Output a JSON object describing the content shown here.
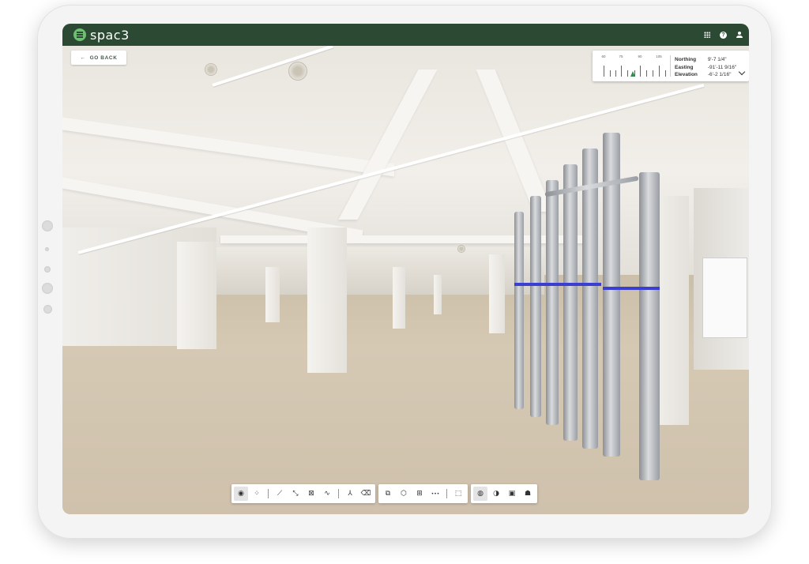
{
  "app": {
    "brand": "spac3"
  },
  "header": {
    "icons": [
      "grid-icon",
      "help-icon",
      "user-icon"
    ]
  },
  "navigation": {
    "go_back_label": "GO BACK",
    "go_back_arrow": "←"
  },
  "compass": {
    "tick_labels": [
      "60",
      "75",
      "90",
      "105"
    ],
    "needle_color": "#2f8f4a",
    "coordinates": [
      {
        "label": "Northing",
        "value": "9'-7 1/4\""
      },
      {
        "label": "Easting",
        "value": "-91'-11 9/16\""
      },
      {
        "label": "Elevation",
        "value": "-6'-2 1/16\""
      }
    ]
  },
  "toolbar": {
    "groups": [
      {
        "name": "view-tools",
        "items": [
          {
            "name": "pano-view-icon",
            "glyph": "◉",
            "active": true
          },
          {
            "name": "scan-points-icon",
            "glyph": "⁘",
            "active": false
          },
          {
            "sep": true
          },
          {
            "name": "measure-icon",
            "glyph": "⟋",
            "active": false
          },
          {
            "name": "measure-segments-icon",
            "glyph": "⤡",
            "active": false
          },
          {
            "name": "area-icon",
            "glyph": "⊠",
            "active": false
          },
          {
            "name": "polyline-icon",
            "glyph": "∿",
            "active": false
          },
          {
            "sep": true
          },
          {
            "name": "axis-icon",
            "glyph": "⅄",
            "active": false
          },
          {
            "name": "eraser-icon",
            "glyph": "⌫",
            "active": false
          }
        ]
      },
      {
        "name": "model-tools",
        "items": [
          {
            "name": "model-overlay-icon",
            "glyph": "⧉",
            "active": false
          },
          {
            "name": "cube-icon",
            "glyph": "⬡",
            "active": false
          },
          {
            "name": "floorplan-grid-icon",
            "glyph": "⊞",
            "active": false
          },
          {
            "name": "more-icon",
            "glyph": "•••",
            "active": false
          },
          {
            "sep": true
          },
          {
            "name": "crop-box-icon",
            "glyph": "⬚",
            "active": false
          }
        ]
      },
      {
        "name": "display-tools",
        "items": [
          {
            "name": "globe-icon",
            "glyph": "◍",
            "active": true
          },
          {
            "name": "contrast-icon",
            "glyph": "◑",
            "active": false
          },
          {
            "name": "comment-icon",
            "glyph": "▣",
            "active": false
          },
          {
            "name": "people-icon",
            "glyph": "☗",
            "active": false
          }
        ]
      }
    ]
  },
  "colors": {
    "app_bar": "#2c4a33",
    "logo_accent": "#6fbf73",
    "pipe_band": "#3a3fd1"
  }
}
